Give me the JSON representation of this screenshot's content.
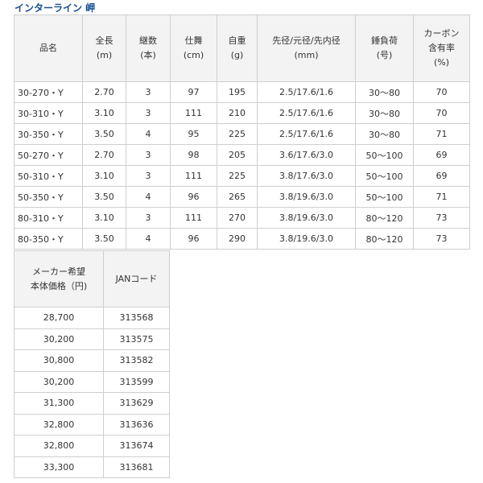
{
  "title": "インターライン 岬",
  "spec_table": {
    "headers": [
      [
        "品名"
      ],
      [
        "全長",
        "(m)"
      ],
      [
        "継数",
        "(本)"
      ],
      [
        "仕舞",
        "(cm)"
      ],
      [
        "自重",
        "(g)"
      ],
      [
        "先径/元径/先内径",
        "(mm)"
      ],
      [
        "錘負荷",
        "(号)"
      ],
      [
        "カーボン",
        "含有率",
        "(%)"
      ]
    ],
    "rows": [
      [
        "30-270・Y",
        "2.70",
        "3",
        "97",
        "195",
        "2.5/17.6/1.6",
        "30～80",
        "70"
      ],
      [
        "30-310・Y",
        "3.10",
        "3",
        "111",
        "210",
        "2.5/17.6/1.6",
        "30～80",
        "70"
      ],
      [
        "30-350・Y",
        "3.50",
        "4",
        "95",
        "225",
        "2.5/17.6/1.6",
        "30～80",
        "71"
      ],
      [
        "50-270・Y",
        "2.70",
        "3",
        "98",
        "205",
        "3.6/17.6/3.0",
        "50～100",
        "69"
      ],
      [
        "50-310・Y",
        "3.10",
        "3",
        "111",
        "225",
        "3.8/17.6/3.0",
        "50～100",
        "69"
      ],
      [
        "50-350・Y",
        "3.50",
        "4",
        "96",
        "265",
        "3.8/19.6/3.0",
        "50～100",
        "71"
      ],
      [
        "80-310・Y",
        "3.10",
        "3",
        "111",
        "270",
        "3.8/19.6/3.0",
        "80～120",
        "73"
      ],
      [
        "80-350・Y",
        "3.50",
        "4",
        "96",
        "290",
        "3.8/19.6/3.0",
        "80～120",
        "73"
      ]
    ]
  },
  "price_table": {
    "headers": [
      [
        "メーカー希望",
        "本体価格（円)"
      ],
      [
        "JANコード"
      ]
    ],
    "rows": [
      [
        "28,700",
        "313568"
      ],
      [
        "30,200",
        "313575"
      ],
      [
        "30,800",
        "313582"
      ],
      [
        "30,200",
        "313599"
      ],
      [
        "31,300",
        "313629"
      ],
      [
        "32,800",
        "313636"
      ],
      [
        "32,800",
        "313674"
      ],
      [
        "33,300",
        "313681"
      ]
    ]
  },
  "colors": {
    "title": "#1a4f93",
    "header_bg": "#f3f3f3",
    "border": "#cfcfcf",
    "text": "#333333"
  }
}
